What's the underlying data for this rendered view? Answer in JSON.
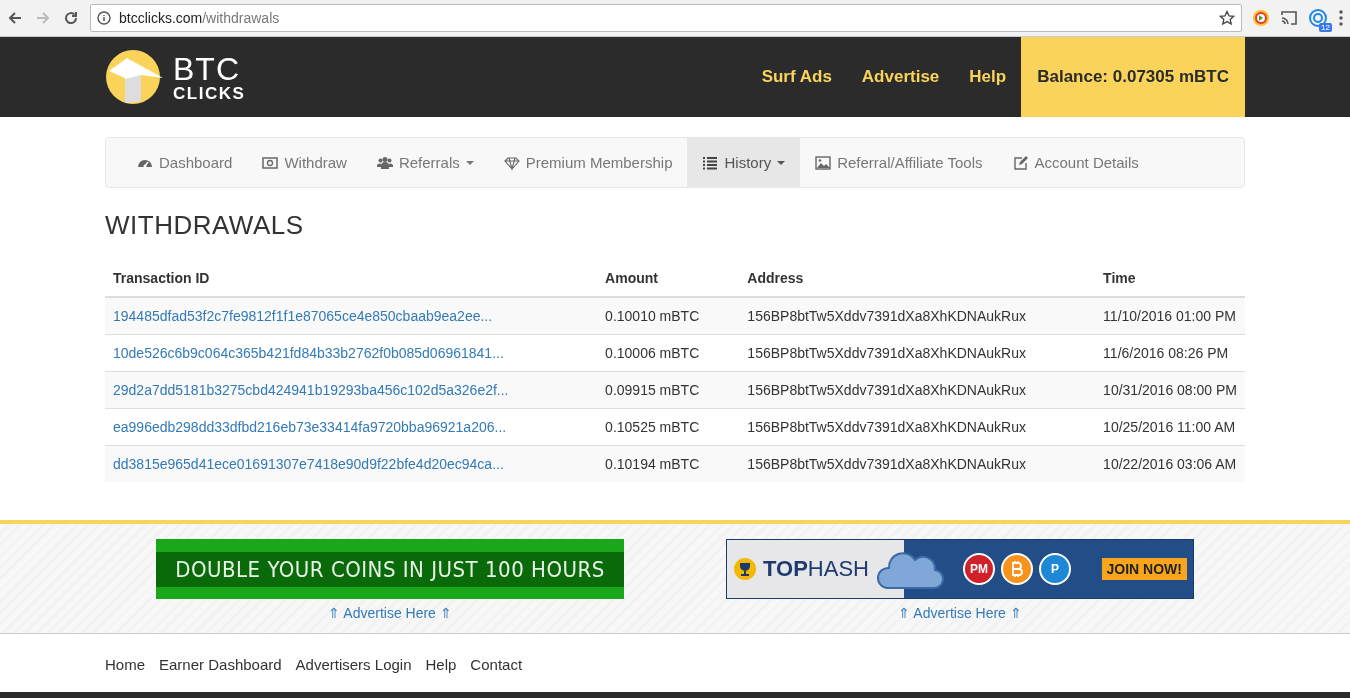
{
  "browser": {
    "url_host": "btcclicks.com",
    "url_path": "/withdrawals",
    "extension_badge": "12"
  },
  "header": {
    "logo_top": "BTC",
    "logo_bottom": "CLICKS",
    "links": [
      "Surf Ads",
      "Advertise",
      "Help"
    ],
    "balance": "Balance: 0.07305 mBTC"
  },
  "nav": [
    {
      "label": "Dashboard",
      "dropdown": false,
      "selected": false
    },
    {
      "label": "Withdraw",
      "dropdown": false,
      "selected": false
    },
    {
      "label": "Referrals",
      "dropdown": true,
      "selected": false
    },
    {
      "label": "Premium Membership",
      "dropdown": false,
      "selected": false
    },
    {
      "label": "History",
      "dropdown": true,
      "selected": true
    },
    {
      "label": "Referral/Affiliate Tools",
      "dropdown": false,
      "selected": false
    },
    {
      "label": "Account Details",
      "dropdown": false,
      "selected": false
    }
  ],
  "heading": "WITHDRAWALS",
  "table": {
    "columns": [
      "Transaction ID",
      "Amount",
      "Address",
      "Time"
    ],
    "rows": [
      [
        "194485dfad53f2c7fe9812f1f1e87065ce4e850cbaab9ea2ee...",
        "0.10010 mBTC",
        "156BP8btTw5Xddv7391dXa8XhKDNAukRux",
        "11/10/2016 01:00 PM"
      ],
      [
        "10de526c6b9c064c365b421fd84b33b2762f0b085d06961841...",
        "0.10006 mBTC",
        "156BP8btTw5Xddv7391dXa8XhKDNAukRux",
        "11/6/2016 08:26 PM"
      ],
      [
        "29d2a7dd5181b3275cbd424941b19293ba456c102d5a326e2f...",
        "0.09915 mBTC",
        "156BP8btTw5Xddv7391dXa8XhKDNAukRux",
        "10/31/2016 08:00 PM"
      ],
      [
        "ea996edb298dd33dfbd216eb73e33414fa9720bba96921a206...",
        "0.10525 mBTC",
        "156BP8btTw5Xddv7391dXa8XhKDNAukRux",
        "10/25/2016 11:00 AM"
      ],
      [
        "dd3815e965d41ece01691307e7418e90d9f22bfe4d20ec94ca...",
        "0.10194 mBTC",
        "156BP8btTw5Xddv7391dXa8XhKDNAukRux",
        "10/22/2016 03:06 AM"
      ]
    ]
  },
  "ads": [
    {
      "kind": "text_banner",
      "text": "DOUBLE YOUR COINS IN JUST 100 HOURS",
      "link": "⇑ Advertise Here ⇑"
    },
    {
      "kind": "tophash_banner",
      "brand": "**TOP**HASH",
      "coins": [
        {
          "kind": "text",
          "text": "PM",
          "color": "#d0202a"
        },
        {
          "kind": "bitcoin",
          "color": "#f7931a"
        },
        {
          "kind": "text",
          "text": "P",
          "color": "#1e88d6"
        }
      ],
      "cta": "JOIN NOW!",
      "link": "⇑ Advertise Here ⇑"
    }
  ],
  "footer": {
    "links": [
      "Home",
      "Earner Dashboard",
      "Advertisers Login",
      "Help",
      "Contact"
    ]
  }
}
